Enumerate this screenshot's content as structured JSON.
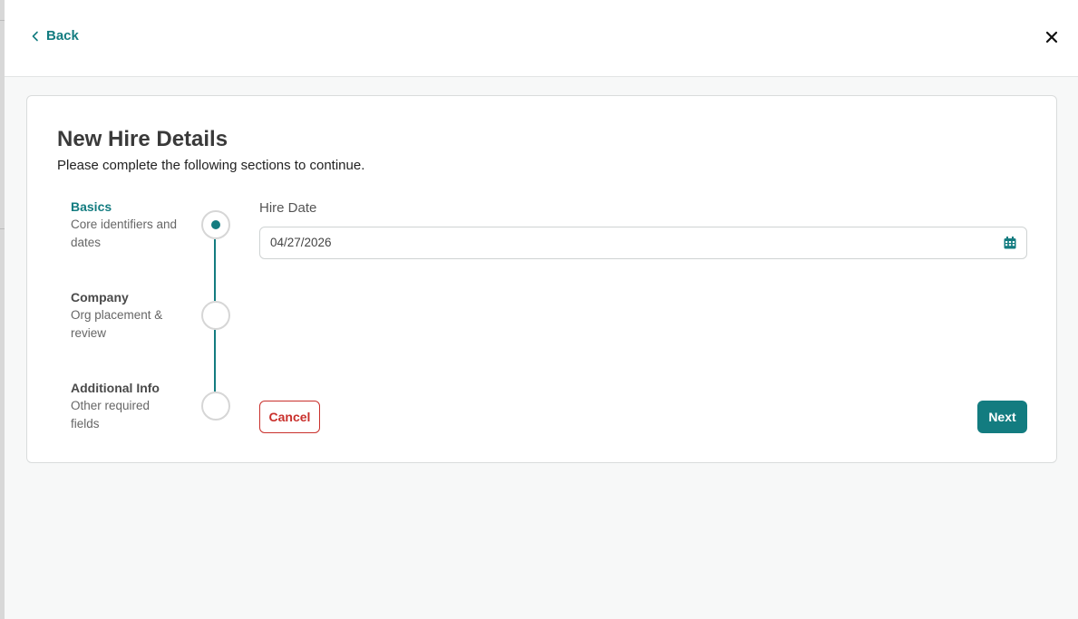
{
  "header": {
    "back_label": "Back"
  },
  "page": {
    "title": "New Hire Details",
    "subtitle": "Please complete the following sections to continue."
  },
  "steps": [
    {
      "title": "Basics",
      "desc_line1": "Core identifiers and",
      "desc_line2": "dates",
      "status": "active"
    },
    {
      "title": "Company",
      "desc_line1": "Org placement &",
      "desc_line2": "review",
      "status": "pending"
    },
    {
      "title": "Additional Info",
      "desc_line1": "Other required",
      "desc_line2": "fields",
      "status": "pending"
    }
  ],
  "form": {
    "hire_date_label": "Hire Date",
    "hire_date_value": "04/27/2026"
  },
  "actions": {
    "cancel_label": "Cancel",
    "next_label": "Next"
  },
  "icons": {
    "back": "chevron-left-icon",
    "close": "close-icon",
    "calendar": "calendar-icon"
  },
  "colors": {
    "accent": "#137c80",
    "danger": "#c9302c"
  }
}
